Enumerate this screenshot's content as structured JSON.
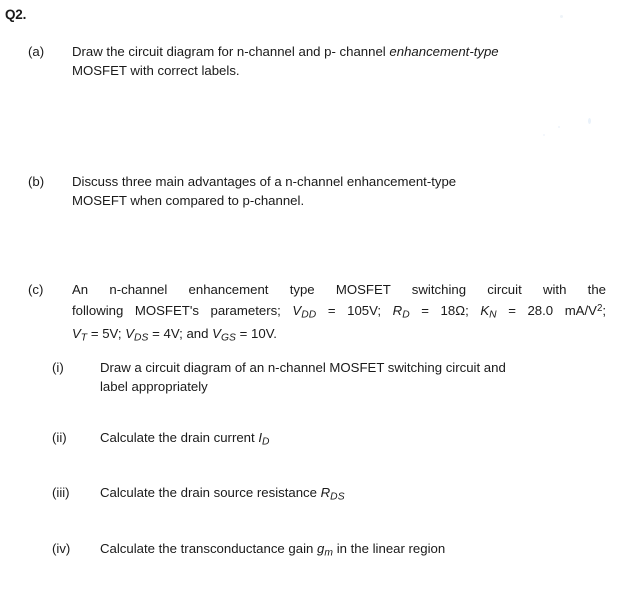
{
  "document": {
    "question_number": "Q2.",
    "parts": [
      {
        "label": "(a)",
        "line1_pre": "Draw the circuit diagram for n-channel and p- channel ",
        "line1_italic": "enhancement-type",
        "line2": "MOSFET with correct labels."
      },
      {
        "label": "(b)",
        "line1": "Discuss three main advantages of a n-channel enhancement-type",
        "line2": "MOSEFT when compared to p-channel."
      },
      {
        "label": "(c)",
        "line1": "An n-channel enhancement type MOSFET switching circuit with the",
        "line2_pre": "following MOSFET's parameters; ",
        "params": [
          {
            "var": "V",
            "sub": "DD",
            "eq": " = ",
            "value": "105V",
            "sep": "; "
          },
          {
            "var": "R",
            "sub": "D",
            "eq": " = ",
            "value": "18Ω",
            "sep": "; "
          },
          {
            "var": "K",
            "sub": "N",
            "eq": " = ",
            "value": "28.0 mA/V",
            "sup": "2",
            "sep": "; "
          },
          {
            "var": "V",
            "sub": "T",
            "eq": " = ",
            "value": "5V",
            "sep": "; "
          },
          {
            "var": "V",
            "sub": "DS",
            "eq": " = ",
            "value": "4V",
            "sep": "; and "
          },
          {
            "var": "V",
            "sub": "GS",
            "eq": " = ",
            "value": "10V",
            "sep": "."
          }
        ]
      }
    ],
    "subitems": [
      {
        "label": "(i)",
        "line1": "Draw a circuit diagram of an n-channel MOSFET switching circuit and",
        "line2": "label appropriately"
      },
      {
        "label": "(ii)",
        "text_pre": "Calculate the drain current ",
        "sym_var": "I",
        "sym_sub": "D",
        "text_post": ""
      },
      {
        "label": "(iii)",
        "text_pre": "Calculate the drain source resistance ",
        "sym_var": "R",
        "sym_sub": "DS",
        "text_post": ""
      },
      {
        "label": "(iv)",
        "text_pre": "Calculate the transconductance gain ",
        "sym_var": "g",
        "sym_sub": "m",
        "text_post": " in the linear region"
      }
    ]
  },
  "colors": {
    "page_background": "#ffffff",
    "text": "#1a1a1a"
  }
}
